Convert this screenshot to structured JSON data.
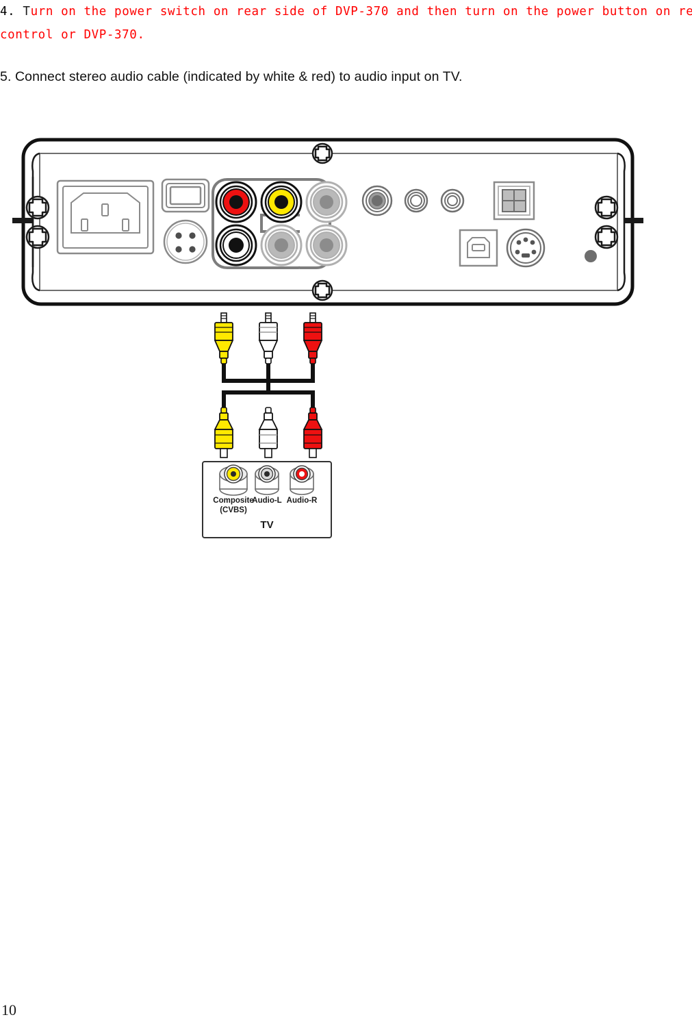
{
  "document": {
    "page_number": "10"
  },
  "instructions": {
    "step4": {
      "number": "4.",
      "lead": "T",
      "line1_red": "urn on the power switch on rear side of DVP-370 and then turn on the power button on remote",
      "line2_red": "control or DVP-370.",
      "color": "#ff0000"
    },
    "step5": {
      "text": "5. Connect stereo audio cable (indicated by white & red) to audio input on TV."
    }
  },
  "rear_panel": {
    "name": "DVP-370 rear panel",
    "connectors": {
      "power_inlet": "iec-power-inlet",
      "power_switch": "rocker-power-switch",
      "din_4pin": "4-pin-din-jack",
      "av_cluster": {
        "audio_r": "audio-right-rca-red",
        "video": "composite-video-rca-yellow",
        "audio_l": "audio-left-rca-white",
        "aux1": "rca-gray-1",
        "aux2": "rca-gray-2",
        "aux3": "rca-gray-3"
      },
      "coax_jack": "coaxial-digital-jack",
      "round_jack_2": "round-jack-medium",
      "round_jack_3": "round-jack-small",
      "grid_port": "2x2-grid-port",
      "usb_b": "usb-type-b-port",
      "svideo": "s-video-mini-din-port",
      "indicator": "status-led-dot"
    },
    "screws": [
      "screw-top-center",
      "screw-bottom-center",
      "screw-left-upper",
      "screw-left-lower",
      "screw-right-upper",
      "screw-right-lower"
    ]
  },
  "cable_assembly": {
    "name": "stereo-av-cable",
    "plugs_top": [
      {
        "id": "plug-top-yellow",
        "color": "#ffe900",
        "signal": "video"
      },
      {
        "id": "plug-top-white",
        "color": "#ffffff",
        "signal": "audio-left"
      },
      {
        "id": "plug-top-red",
        "color": "#ee1111",
        "signal": "audio-right"
      }
    ],
    "plugs_bottom": [
      {
        "id": "plug-bottom-yellow",
        "color": "#ffe900",
        "signal": "video"
      },
      {
        "id": "plug-bottom-white",
        "color": "#ffffff",
        "signal": "audio-left"
      },
      {
        "id": "plug-bottom-red",
        "color": "#ee1111",
        "signal": "audio-right"
      }
    ]
  },
  "tv_panel": {
    "title": "TV",
    "jacks": [
      {
        "label_line1": "Composite",
        "label_line2": "(CVBS)",
        "color": "#ffe900",
        "id": "tv-composite-jack"
      },
      {
        "label_line1": "Audio-L",
        "label_line2": "",
        "color": "#ffffff",
        "id": "tv-audio-l-jack"
      },
      {
        "label_line1": "Audio-R",
        "label_line2": "",
        "color": "#ee1111",
        "id": "tv-audio-r-jack"
      }
    ]
  },
  "colors": {
    "red_text": "#ff0000",
    "yellow_connector": "#ffe900",
    "red_connector": "#ee1111",
    "gray_connector": "#9b9b9b",
    "outline": "#808080",
    "dark_outline": "#1a1a1a"
  }
}
